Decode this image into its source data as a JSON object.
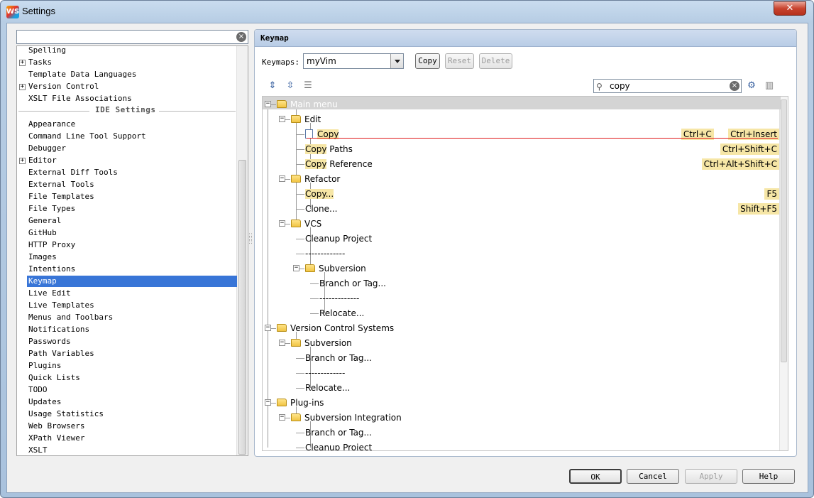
{
  "window": {
    "title": "Settings",
    "close_glyph": "✕",
    "app_icon_text": "WS"
  },
  "search": {
    "value": "",
    "clear_icon": "clear-icon"
  },
  "left_tree": {
    "items_top": [
      {
        "label": "Spelling",
        "expandable": false
      },
      {
        "label": "Tasks",
        "expandable": true
      },
      {
        "label": "Template Data Languages",
        "expandable": false
      },
      {
        "label": "Version Control",
        "expandable": true
      },
      {
        "label": "XSLT File Associations",
        "expandable": false
      }
    ],
    "section_label": "IDE Settings",
    "items_ide": [
      {
        "label": "Appearance",
        "expandable": false
      },
      {
        "label": "Command Line Tool Support",
        "expandable": false
      },
      {
        "label": "Debugger",
        "expandable": false
      },
      {
        "label": "Editor",
        "expandable": true
      },
      {
        "label": "External Diff Tools",
        "expandable": false
      },
      {
        "label": "External Tools",
        "expandable": false
      },
      {
        "label": "File Templates",
        "expandable": false
      },
      {
        "label": "File Types",
        "expandable": false
      },
      {
        "label": "General",
        "expandable": false
      },
      {
        "label": "GitHub",
        "expandable": false
      },
      {
        "label": "HTTP Proxy",
        "expandable": false
      },
      {
        "label": "Images",
        "expandable": false
      },
      {
        "label": "Intentions",
        "expandable": false
      },
      {
        "label": "Keymap",
        "expandable": false,
        "selected": true
      },
      {
        "label": "Live Edit",
        "expandable": false
      },
      {
        "label": "Live Templates",
        "expandable": false
      },
      {
        "label": "Menus and Toolbars",
        "expandable": false
      },
      {
        "label": "Notifications",
        "expandable": false
      },
      {
        "label": "Passwords",
        "expandable": false
      },
      {
        "label": "Path Variables",
        "expandable": false
      },
      {
        "label": "Plugins",
        "expandable": false
      },
      {
        "label": "Quick Lists",
        "expandable": false
      },
      {
        "label": "TODO",
        "expandable": false
      },
      {
        "label": "Updates",
        "expandable": false
      },
      {
        "label": "Usage Statistics",
        "expandable": false
      },
      {
        "label": "Web Browsers",
        "expandable": false
      },
      {
        "label": "XPath Viewer",
        "expandable": false
      },
      {
        "label": "XSLT",
        "expandable": false
      }
    ]
  },
  "keymap": {
    "header": "Keymap",
    "keymaps_label": "Keymaps:",
    "selected_keymap": "myVim",
    "buttons": {
      "copy": "Copy",
      "reset": "Reset",
      "delete": "Delete"
    },
    "filter_value": "copy",
    "toolbar_icons": [
      "expand-all-icon",
      "collapse-all-icon",
      "edit-shortcuts-icon"
    ],
    "find_icons": [
      "find-by-shortcut-icon",
      "clear-filter-icon"
    ]
  },
  "tree_rows": [
    {
      "text": "Main menu",
      "icon": "folder",
      "level": 0,
      "expanded": true,
      "root": true
    },
    {
      "text": "Edit",
      "icon": "folder",
      "level": 1,
      "expanded": true
    },
    {
      "hl": "Copy",
      "text": "",
      "icon": "doc",
      "level": 2,
      "shortcuts": [
        "Ctrl+C",
        "Ctrl+Insert"
      ]
    },
    {
      "hl": "Copy",
      "text": " Paths",
      "level": 2,
      "shortcuts": [
        "Ctrl+Shift+C"
      ]
    },
    {
      "hl": "Copy",
      "text": " Reference",
      "level": 2,
      "shortcuts": [
        "Ctrl+Alt+Shift+C"
      ]
    },
    {
      "text": "Refactor",
      "icon": "folder",
      "level": 1,
      "expanded": true
    },
    {
      "hl": "Copy...",
      "text": "",
      "level": 2,
      "shortcuts": [
        "F5"
      ]
    },
    {
      "text": "Clone...",
      "level": 2,
      "shortcuts": [
        "Shift+F5"
      ]
    },
    {
      "text": "VCS",
      "icon": "folder",
      "level": 1,
      "expanded": true
    },
    {
      "text": "Cleanup Project",
      "level": 2
    },
    {
      "text": "-------------",
      "level": 2
    },
    {
      "text": "Subversion",
      "icon": "folder",
      "level": 2,
      "expanded": true
    },
    {
      "text": "Branch or Tag...",
      "level": 3
    },
    {
      "text": "-------------",
      "level": 3
    },
    {
      "text": "Relocate...",
      "level": 3
    },
    {
      "text": "Version Control Systems",
      "icon": "folder",
      "level": 0,
      "expanded": true
    },
    {
      "text": "Subversion",
      "icon": "folder",
      "level": 1,
      "expanded": true
    },
    {
      "text": "Branch or Tag...",
      "level": 2
    },
    {
      "text": "-------------",
      "level": 2
    },
    {
      "text": "Relocate...",
      "level": 2
    },
    {
      "text": "Plug-ins",
      "icon": "folder",
      "level": 0,
      "expanded": true
    },
    {
      "text": "Subversion Integration",
      "icon": "folder",
      "level": 1,
      "expanded": true
    },
    {
      "text": "Branch or Tag...",
      "level": 2
    },
    {
      "text": "Cleanup Project",
      "level": 2
    }
  ],
  "dialog_buttons": {
    "ok": "OK",
    "cancel": "Cancel",
    "apply": "Apply",
    "help": "Help"
  }
}
